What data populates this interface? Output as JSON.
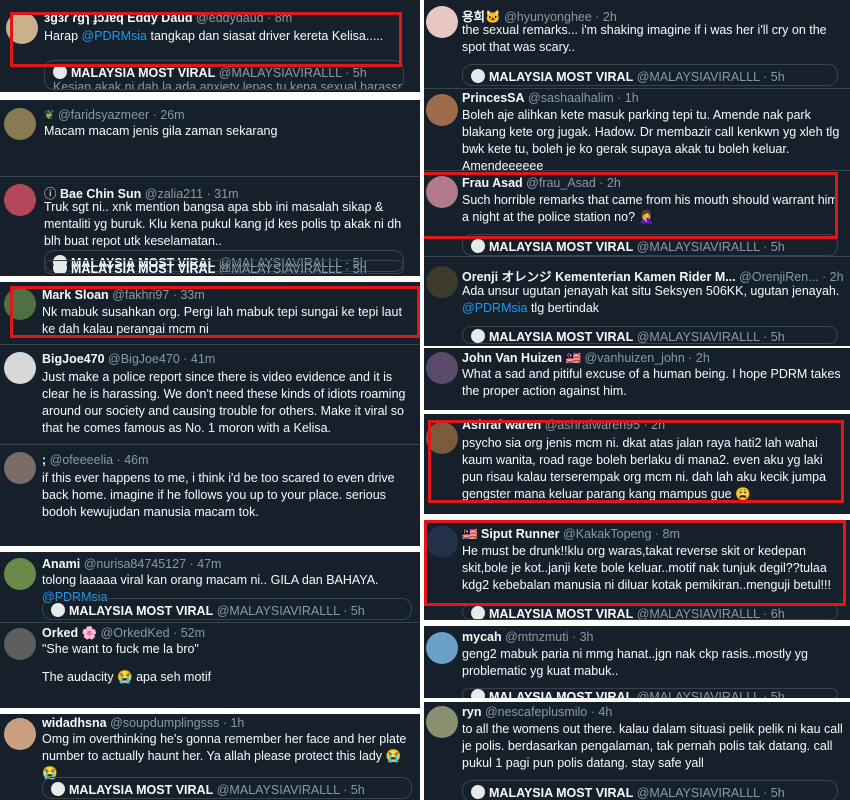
{
  "left_column": [
    {
      "key": "eddy",
      "name": "ɜgɜɾ ɾgɿ ɟɔɹɐq Eddy Daud",
      "handle": "@eddydaud · 8m",
      "text_parts": [
        "Harap ",
        "@PDRMsia",
        "  tangkap dan siasat driver kereta Kelisa....."
      ],
      "quote_name": "MALAYSIA MOST VIRAL",
      "quote_handle": "@MALAYSIAVIRALLL · 5h",
      "quote_snippet": "Kesian akak ni dah la ada anxiety lepas tu kena sexual harassment"
    },
    {
      "key": "farids",
      "name": "",
      "handle": "@faridsyazmeer · 26m",
      "text": "Macam macam jenis gila zaman sekarang",
      "quote_name": "MALAYSIA MOST VIRAL",
      "quote_handle": "@MALAYSIAVIRALLL · 5h"
    },
    {
      "key": "baechin",
      "name": "Bae Chin Sun",
      "handle": "@zalia211 · 31m",
      "text": "Truk sgt ni.. xnk mention bangsa apa sbb ini masalah sikap & mentaliti yg buruk. Klu kena pukul kang jd kes polis tp akak ni dh blh buat repot utk keselamatan..",
      "quote_name": "MALAYSIA MOST VIRAL",
      "quote_handle": "@MALAYSIAVIRALLL · 5h"
    },
    {
      "key": "marksloan",
      "name": "Mark Sloan",
      "handle": "@fakhri97 · 33m",
      "text": "Nk mabuk susahkan org. Pergi lah mabuk tepi sungai ke tepi laut ke dah kalau perangai mcm ni"
    },
    {
      "key": "bigjoe",
      "name": "BigJoe470",
      "handle": "@BigJoe470 · 41m",
      "text": "Just make a police report since there is video evidence and it is clear he is harassing. We don't need these kinds of idiots roaming around our society and causing trouble for others. Make it viral so that he comes famous as No. 1 moron with a Kelisa."
    },
    {
      "key": "ofeee",
      "name": ";",
      "handle": "@ofeeeelia · 46m",
      "text": "if this ever happens to me, i think i'd be too scared to even drive back home. imagine if he follows you up to your place. serious bodoh kewujudan manusia macam tok."
    },
    {
      "key": "anami",
      "name": "Anami",
      "handle": "@nurisa84745127 · 47m",
      "text_parts": [
        "tolong laaaaa viral kan orang macam ni.. GILA dan BAHAYA. ",
        "@PDRMsia"
      ],
      "quote_name": "MALAYSIA MOST VIRAL",
      "quote_handle": "@MALAYSIAVIRALLL · 5h"
    },
    {
      "key": "orked",
      "name": "Orked 🌸",
      "handle": "@OrkedKed · 52m",
      "line1": "\"She want to fuck me la bro\"",
      "line2": "The audacity 😭 apa seh motif"
    },
    {
      "key": "widad",
      "name": "widadhsna",
      "handle": "@soupdumplingsss · 1h",
      "text": "Omg im overthinking he's gonna remember her face and her plate number to actually haunt her. Ya allah please protect this lady 😭😭",
      "quote_name": "MALAYSIA MOST VIRAL",
      "quote_handle": "@MALAYSIAVIRALLL · 5h"
    }
  ],
  "right_column": [
    {
      "key": "yonghee",
      "name": "용희🐱",
      "handle": "@hyunyonghee · 2h",
      "text": "the sexual remarks... i'm shaking imagine if i was her i'll cry on the spot that was scary..",
      "quote_name": "MALAYSIA MOST VIRAL",
      "quote_handle": "@MALAYSIAVIRALLL · 5h"
    },
    {
      "key": "princessa",
      "name": "PrincesSA",
      "handle": "@sashaalhalim · 1h",
      "text": "Boleh aje alihkan kete masuk parking tepi tu. Amende nak park blakang kete org jugak. Hadow. Dr membazir call kenkwn yg xleh tlg bwk kete tu, boleh je ko gerak supaya akak tu boleh keluar. Amendeeeeee"
    },
    {
      "key": "frauasad",
      "name": "Frau Asad",
      "handle": "@frau_Asad · 2h",
      "text": "Such horrible remarks that came from his mouth should warrant him a night at the police station no? 🤦‍♀️",
      "quote_name": "MALAYSIA MOST VIRAL",
      "quote_handle": "@MALAYSIAVIRALLL · 5h"
    },
    {
      "key": "orenji",
      "name": "Orenji オレンジ Kementerian Kamen Rider M...",
      "handle": "@OrenjiRen... · 2h",
      "text_parts": [
        "Ada unsur ugutan jenayah kat situ Seksyen 506KK, ugutan jenayah. ",
        "@PDRMsia",
        " tlg bertindak"
      ],
      "quote_name": "MALAYSIA MOST VIRAL",
      "quote_handle": "@MALAYSIAVIRALLL · 5h"
    },
    {
      "key": "vanhuizen",
      "name": "John Van Huizen 🇲🇾",
      "handle": "@vanhuizen_john · 2h",
      "text": "What a sad and pitiful excuse of a human being. I hope PDRM takes the proper action against him."
    },
    {
      "key": "ashraf",
      "name": "Ashraf waren",
      "handle": "@ashrafwaren95 · 2h",
      "text": "psycho sia org jenis mcm ni. dkat atas jalan raya hati2 lah wahai kaum wanita, road rage boleh berlaku di mana2. even aku yg laki pun risau kalau terserempak org mcm ni. dah lah aku kecik jumpa gengster mana keluar parang kang mampus gue 😩"
    },
    {
      "key": "siput",
      "name": "🇲🇾 Siput Runner",
      "handle": "@KakakTopeng · 8m",
      "text": "He must be drunk!!klu org waras,takat reverse skit or kedepan skit,bole je kot..janji kete bole keluar..motif nak tunjuk degil??tulaa kdg2 kebebalan manusia ni diluar kotak pemikiran..menguji betul!!!",
      "quote_name": "MALAYSIA MOST VIRAL",
      "quote_handle": "@MALAYSIAVIRALLL · 6h"
    },
    {
      "key": "mycah",
      "name": "mycah",
      "handle": "@mtnzmuti · 3h",
      "text": "geng2 mabuk paria ni mmg hanat..jgn nak ckp rasis..mostly yg problematic yg kuat mabuk..",
      "quote_name": "MALAYSIA MOST VIRAL",
      "quote_handle": "@MALAYSIAVIRALLL · 5h"
    },
    {
      "key": "ryn",
      "name": "ryn",
      "handle": "@nescafeplusmilo · 4h",
      "text": "to all the womens out there. kalau dalam situasi pelik pelik ni kau call je polis. berdasarkan pengalaman, tak pernah polis tak datang. call pukul 1 pagi pun polis datang. stay safe yall",
      "quote_name": "MALAYSIA MOST VIRAL",
      "quote_handle": "@MALAYSIAVIRALLL · 5h"
    }
  ],
  "colors": {
    "background": "#15202b",
    "text": "#f7f9f9",
    "muted": "#8b98a5",
    "link": "#1d9bf0",
    "highlight_box": "#e0161b",
    "border": "#38444d"
  }
}
